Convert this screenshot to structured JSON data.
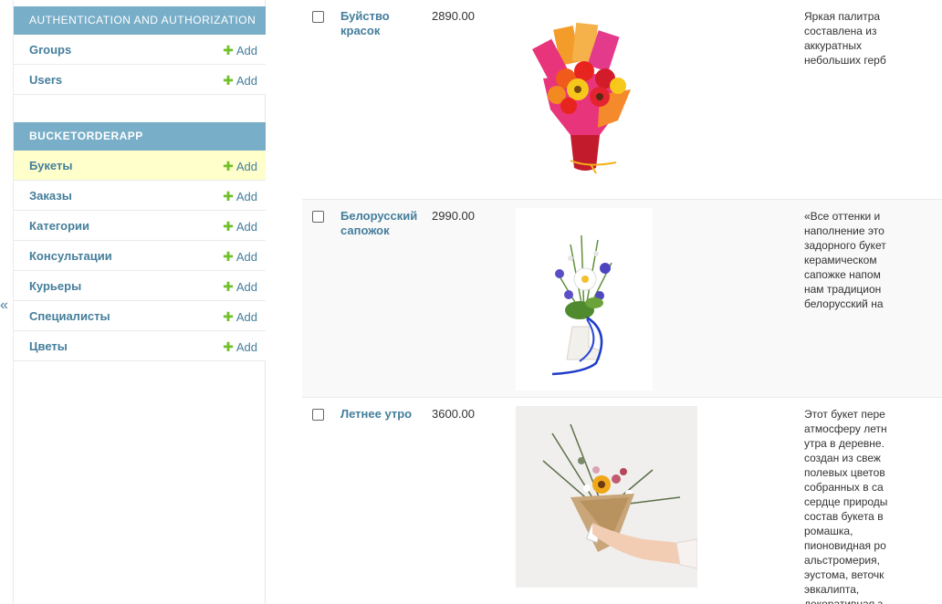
{
  "sidebar": {
    "collapse_label": "«",
    "modules": [
      {
        "caption": "Authentication and Authorization",
        "models": [
          {
            "name": "Groups",
            "add": "Add"
          },
          {
            "name": "Users",
            "add": "Add"
          }
        ]
      },
      {
        "caption": "BUCKETORDERAPP",
        "models": [
          {
            "name": "Букеты",
            "add": "Add",
            "current": true
          },
          {
            "name": "Заказы",
            "add": "Add"
          },
          {
            "name": "Категории",
            "add": "Add"
          },
          {
            "name": "Консультации",
            "add": "Add"
          },
          {
            "name": "Курьеры",
            "add": "Add"
          },
          {
            "name": "Специалисты",
            "add": "Add"
          },
          {
            "name": "Цветы",
            "add": "Add"
          }
        ]
      }
    ]
  },
  "results": [
    {
      "name": "Буйство красок",
      "price": "2890.00",
      "description": "Яркая палитра\nсоставлена из\nаккуратных\nнебольших герб"
    },
    {
      "name": "Белорусский сапожок",
      "price": "2990.00",
      "description": "«Все оттенки и\nнаполнение это\nзадорного букет\nкерамическом\nсапожке напом\nнам традицион\nбелорусский на"
    },
    {
      "name": "Летнее утро",
      "price": "3600.00",
      "description": "Этот букет пере\nатмосферу летн\nутра в деревне.\nсоздан из свеж\nполевых цветов\nсобранных в са\nсердце природы\nсостав букета в\nромашка,\nпионовидная ро\nальстромерия,\nэустома, веточк\nэвкалипта,\nдекоративная з"
    }
  ],
  "colors": {
    "module_caption_bg": "#79aec8",
    "link": "#447e9b",
    "add_plus": "#70bf2b",
    "current_row_bg": "#ffffcc"
  }
}
